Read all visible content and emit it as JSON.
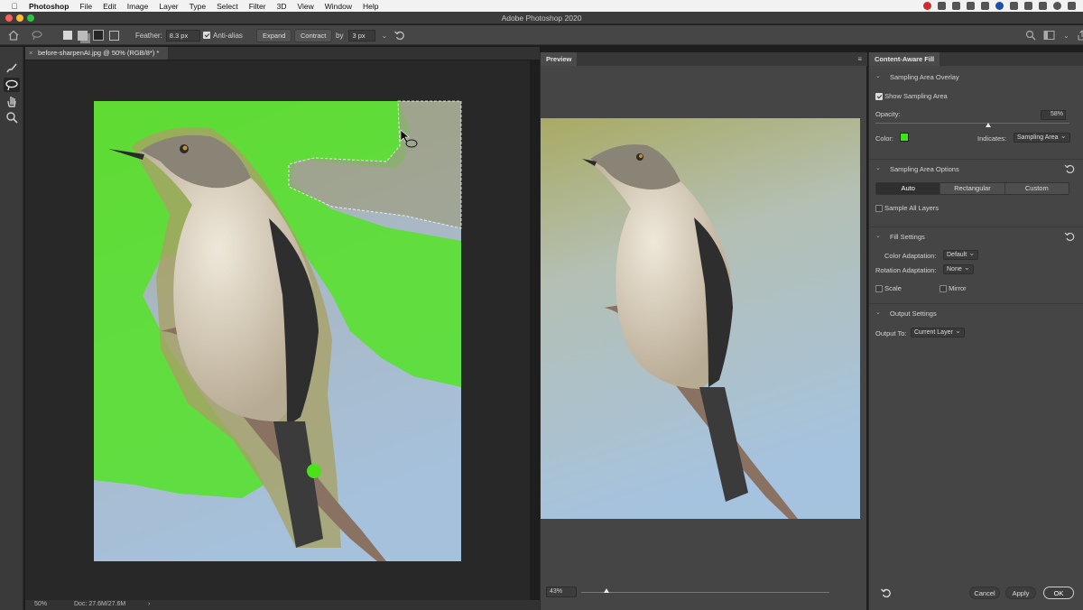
{
  "menubar": {
    "app_name": "Photoshop",
    "items": [
      "File",
      "Edit",
      "Image",
      "Layer",
      "Type",
      "Select",
      "Filter",
      "3D",
      "View",
      "Window",
      "Help"
    ]
  },
  "window": {
    "title": "Adobe Photoshop 2020"
  },
  "options_bar": {
    "feather_label": "Feather:",
    "feather_value": "8.3 px",
    "anti_alias_label": "Anti-alias",
    "anti_alias_checked": true,
    "expand_label": "Expand",
    "contract_label": "Contract",
    "by_label": "by",
    "by_value": "3 px"
  },
  "document": {
    "tab_title": "before-sharpenAI.jpg @ 50% (RGB/8*) *",
    "status_zoom": "50%",
    "status_doc": "Doc: 27.6M/27.6M"
  },
  "preview": {
    "tab_label": "Preview",
    "zoom": "43%",
    "zoom_level": 0.1
  },
  "panel": {
    "title": "Content-Aware Fill",
    "sampling_overlay": {
      "header": "Sampling Area Overlay",
      "show_label": "Show Sampling Area",
      "show_checked": true,
      "opacity_label": "Opacity:",
      "opacity_value": "58%",
      "opacity_level": 0.58,
      "color_label": "Color:",
      "color": "#3fe21a",
      "indicates_label": "Indicates:",
      "indicates_value": "Sampling Area"
    },
    "sampling_options": {
      "header": "Sampling Area Options",
      "modes": [
        "Auto",
        "Rectangular",
        "Custom"
      ],
      "selected_mode": "Auto",
      "sample_all_label": "Sample All Layers"
    },
    "fill_settings": {
      "header": "Fill Settings",
      "color_adaptation_label": "Color Adaptation:",
      "color_adaptation_value": "Default",
      "rotation_adaptation_label": "Rotation Adaptation:",
      "rotation_adaptation_value": "None",
      "scale_label": "Scale",
      "mirror_label": "Mirror"
    },
    "output_settings": {
      "header": "Output Settings",
      "output_to_label": "Output To:",
      "output_to_value": "Current Layer"
    },
    "buttons": {
      "cancel": "Cancel",
      "apply": "Apply",
      "ok": "OK"
    }
  },
  "colors": {
    "overlay_green": "#3fe21a",
    "ui_dark": "#454545"
  }
}
